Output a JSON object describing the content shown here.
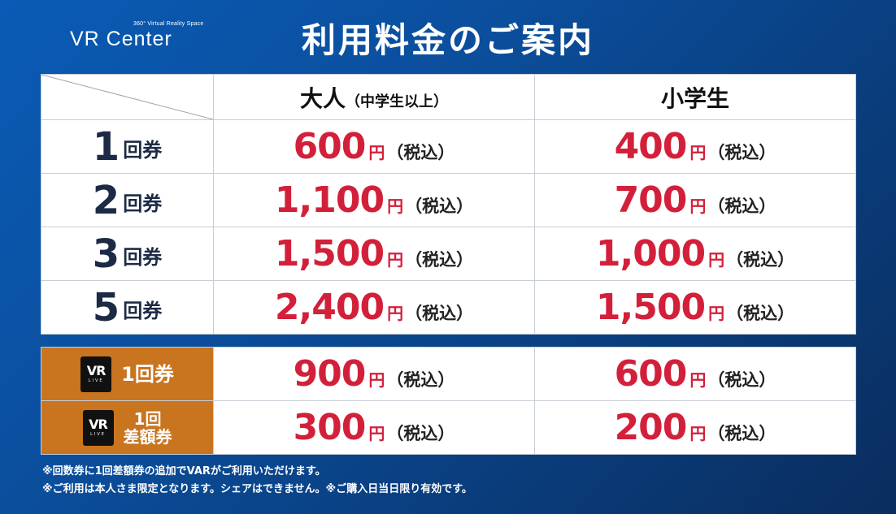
{
  "logo": {
    "text": "VR Center",
    "tagline": "360° Virtual Reality Space"
  },
  "title": "利用料金のご案内",
  "header": {
    "adult": "大人",
    "adult_sub": "（中学生以上）",
    "child": "小学生"
  },
  "rows": [
    {
      "num": "1",
      "unit": "回券",
      "adult": "600",
      "child": "400"
    },
    {
      "num": "2",
      "unit": "回券",
      "adult": "1,100",
      "child": "700"
    },
    {
      "num": "3",
      "unit": "回券",
      "adult": "1,500",
      "child": "1,000"
    },
    {
      "num": "5",
      "unit": "回券",
      "adult": "2,400",
      "child": "1,500"
    }
  ],
  "price_suffix": {
    "yen": "円",
    "tax": "（税込）"
  },
  "vr_badge": {
    "main": "VR",
    "small": "LIVE"
  },
  "vr_rows": [
    {
      "label_line1": "1回券",
      "label_line2": "",
      "adult": "900",
      "child": "600"
    },
    {
      "label_line1": "1回",
      "label_line2": "差額券",
      "adult": "300",
      "child": "200"
    }
  ],
  "notes": [
    "※回数券に1回差額券の追加でVARがご利用いただけます。",
    "※ご利用は本人さま限定となります。シェアはできません。※ご購入日当日限り有効です。"
  ],
  "colors": {
    "price_red": "#d3203a",
    "vr_orange": "#c9741f",
    "label_navy": "#1c2a45"
  }
}
